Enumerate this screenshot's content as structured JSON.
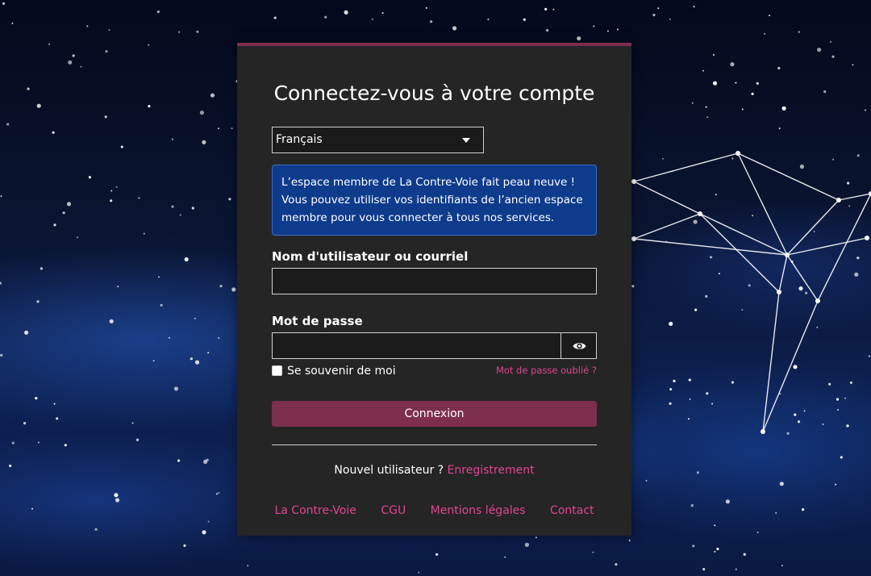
{
  "page": {
    "title": "Connectez-vous à votre compte"
  },
  "language": {
    "selected": "Français"
  },
  "notice": {
    "lines": [
      "L’espace membre de La Contre-Voie fait peau neuve !",
      "Vous pouvez utiliser vos identifiants de l’ancien espace",
      "membre pour vous connecter à tous nos services."
    ]
  },
  "form": {
    "username_label": "Nom d'utilisateur ou courriel",
    "username_value": "",
    "password_label": "Mot de passe",
    "password_value": "",
    "show_password_icon": "eye-icon",
    "remember_label": "Se souvenir de moi",
    "remember_checked": false,
    "forgot_label": "Mot de passe oublié ?",
    "submit_label": "Connexion"
  },
  "register": {
    "prompt": "Nouvel utilisateur ?",
    "link_label": "Enregistrement"
  },
  "footer": {
    "links": [
      "La Contre-Voie",
      "CGU",
      "Mentions légales",
      "Contact"
    ]
  },
  "colors": {
    "accent": "#7e2f4d",
    "link": "#e0468e",
    "card_bg": "#252526",
    "notice_bg": "#0e3b8c"
  }
}
